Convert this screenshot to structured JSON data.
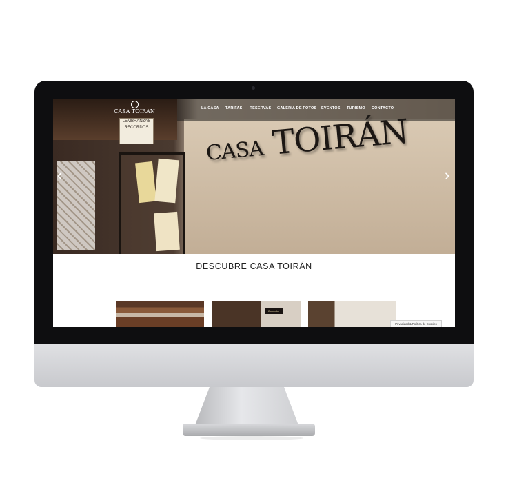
{
  "logo": {
    "text": "CASA TOIRÁN"
  },
  "nav": {
    "items": [
      "LA CASA",
      "TARIFAS",
      "RESERVAS",
      "GALERÍA DE FOTOS",
      "EVENTOS",
      "TURISMO",
      "CONTACTO"
    ]
  },
  "hero": {
    "sign_small": "CASA",
    "sign_big": "TOIRÁN",
    "board_lines": [
      "LEMBRANZAS",
      "RECORDOS"
    ],
    "prev_arrow": "‹",
    "next_arrow": "›"
  },
  "main": {
    "title": "DESCUBRE CASA TOIRÁN",
    "thumb_sign": "Comedor"
  },
  "cookie": {
    "label": "Privacidad & Política de Cookies"
  },
  "colors": {
    "monitor": "#0e0e10",
    "chin": "#dfe0e3",
    "nav_bg": "#1e1c1a",
    "text": "#222222"
  }
}
